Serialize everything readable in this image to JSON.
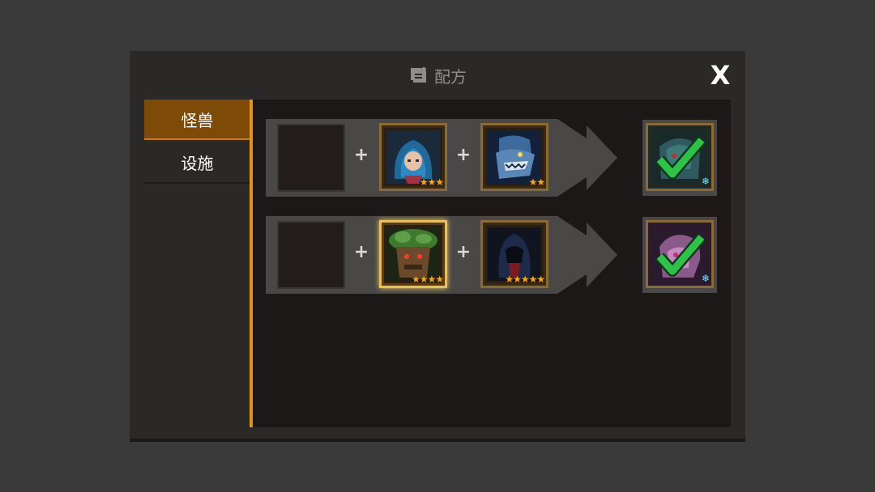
{
  "window": {
    "title": "配方",
    "title_icon": "scroll-icon",
    "close_label": "X"
  },
  "tabs": [
    {
      "label": "怪兽",
      "active": true
    },
    {
      "label": "设施",
      "active": false
    }
  ],
  "recipes": [
    {
      "ingredient_1": {
        "stars": "★★★",
        "portrait": "blue-haired-girl-icon"
      },
      "ingredient_2": {
        "stars": "★★",
        "portrait": "blue-fish-monster-icon"
      },
      "result": {
        "portrait": "dark-armored-monster-icon",
        "completed": true,
        "badge": "❄"
      },
      "plus": "+"
    },
    {
      "ingredient_1": {
        "stars": "★★★★",
        "portrait": "tree-golem-icon"
      },
      "ingredient_2": {
        "stars": "★★★★★",
        "portrait": "hooded-figure-icon"
      },
      "result": {
        "portrait": "pink-beast-icon",
        "completed": true,
        "badge": "❄"
      },
      "plus": "+"
    }
  ],
  "colors": {
    "accent": "#e4911a",
    "active_tab": "#7d4a07",
    "check": "#2ec24a",
    "star": "#f5a623"
  }
}
